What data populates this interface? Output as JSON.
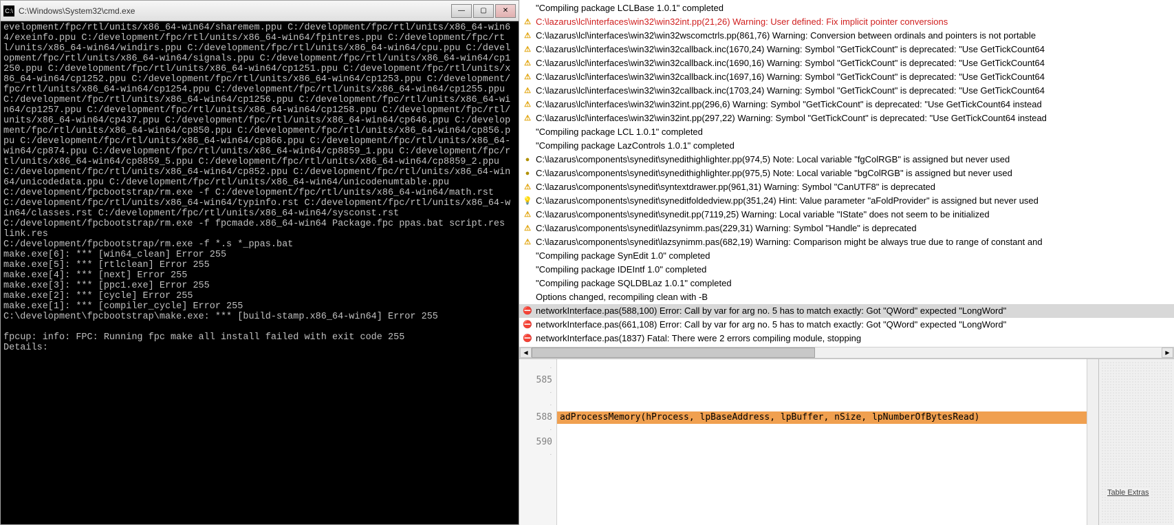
{
  "cmd": {
    "title": "C:\\Windows\\System32\\cmd.exe",
    "icon_text": "C:\\",
    "body": "evelopment/fpc/rtl/units/x86_64-win64/sharemem.ppu C:/development/fpc/rtl/units/x86_64-win64/exeinfo.ppu C:/development/fpc/rtl/units/x86_64-win64/fpintres.ppu C:/development/fpc/rtl/units/x86_64-win64/windirs.ppu C:/development/fpc/rtl/units/x86_64-win64/cpu.ppu C:/development/fpc/rtl/units/x86_64-win64/signals.ppu C:/development/fpc/rtl/units/x86_64-win64/cp1250.ppu C:/development/fpc/rtl/units/x86_64-win64/cp1251.ppu C:/development/fpc/rtl/units/x86_64-win64/cp1252.ppu C:/development/fpc/rtl/units/x86_64-win64/cp1253.ppu C:/development/fpc/rtl/units/x86_64-win64/cp1254.ppu C:/development/fpc/rtl/units/x86_64-win64/cp1255.ppu C:/development/fpc/rtl/units/x86_64-win64/cp1256.ppu C:/development/fpc/rtl/units/x86_64-win64/cp1257.ppu C:/development/fpc/rtl/units/x86_64-win64/cp1258.ppu C:/development/fpc/rtl/units/x86_64-win64/cp437.ppu C:/development/fpc/rtl/units/x86_64-win64/cp646.ppu C:/development/fpc/rtl/units/x86_64-win64/cp850.ppu C:/development/fpc/rtl/units/x86_64-win64/cp856.ppu C:/development/fpc/rtl/units/x86_64-win64/cp866.ppu C:/development/fpc/rtl/units/x86_64-win64/cp874.ppu C:/development/fpc/rtl/units/x86_64-win64/cp8859_1.ppu C:/development/fpc/rtl/units/x86_64-win64/cp8859_5.ppu C:/development/fpc/rtl/units/x86_64-win64/cp8859_2.ppu C:/development/fpc/rtl/units/x86_64-win64/cp852.ppu C:/development/fpc/rtl/units/x86_64-win64/unicodedata.ppu C:/development/fpc/rtl/units/x86_64-win64/unicodenumtable.ppu\nC:/development/fpcbootstrap/rm.exe -f C:/development/fpc/rtl/units/x86_64-win64/math.rst C:/development/fpc/rtl/units/x86_64-win64/typinfo.rst C:/development/fpc/rtl/units/x86_64-win64/classes.rst C:/development/fpc/rtl/units/x86_64-win64/sysconst.rst\nC:/development/fpcbootstrap/rm.exe -f fpcmade.x86_64-win64 Package.fpc ppas.bat script.res link.res\nC:/development/fpcbootstrap/rm.exe -f *.s *_ppas.bat\nmake.exe[6]: *** [win64_clean] Error 255\nmake.exe[5]: *** [rtlclean] Error 255\nmake.exe[4]: *** [next] Error 255\nmake.exe[3]: *** [ppc1.exe] Error 255\nmake.exe[2]: *** [cycle] Error 255\nmake.exe[1]: *** [compiler_cycle] Error 255\nC:\\development\\fpcbootstrap\\make.exe: *** [build-stamp.x86_64-win64] Error 255\n\nfpcup: info: FPC: Running fpc make all install failed with exit code 255\nDetails:"
  },
  "messages": [
    {
      "icon": "",
      "cls": "",
      "text": "\"Compiling package LCLBase 1.0.1\" completed"
    },
    {
      "icon": "⚠",
      "cls": "icon-warning",
      "text": "C:\\lazarus\\lcl\\interfaces\\win32\\win32int.pp(21,26) Warning: User defined: Fix implicit pointer conversions",
      "red": true
    },
    {
      "icon": "⚠",
      "cls": "icon-warning",
      "text": "C:\\lazarus\\lcl\\interfaces\\win32\\win32wscomctrls.pp(861,76) Warning: Conversion between ordinals and pointers is not portable"
    },
    {
      "icon": "⚠",
      "cls": "icon-warning",
      "text": "C:\\lazarus\\lcl\\interfaces\\win32\\win32callback.inc(1670,24) Warning: Symbol \"GetTickCount\" is deprecated: \"Use GetTickCount64"
    },
    {
      "icon": "⚠",
      "cls": "icon-warning",
      "text": "C:\\lazarus\\lcl\\interfaces\\win32\\win32callback.inc(1690,16) Warning: Symbol \"GetTickCount\" is deprecated: \"Use GetTickCount64"
    },
    {
      "icon": "⚠",
      "cls": "icon-warning",
      "text": "C:\\lazarus\\lcl\\interfaces\\win32\\win32callback.inc(1697,16) Warning: Symbol \"GetTickCount\" is deprecated: \"Use GetTickCount64"
    },
    {
      "icon": "⚠",
      "cls": "icon-warning",
      "text": "C:\\lazarus\\lcl\\interfaces\\win32\\win32callback.inc(1703,24) Warning: Symbol \"GetTickCount\" is deprecated: \"Use GetTickCount64"
    },
    {
      "icon": "⚠",
      "cls": "icon-warning",
      "text": "C:\\lazarus\\lcl\\interfaces\\win32\\win32int.pp(296,6) Warning: Symbol \"GetTickCount\" is deprecated: \"Use GetTickCount64 instead"
    },
    {
      "icon": "⚠",
      "cls": "icon-warning",
      "text": "C:\\lazarus\\lcl\\interfaces\\win32\\win32int.pp(297,22) Warning: Symbol \"GetTickCount\" is deprecated: \"Use GetTickCount64 instead"
    },
    {
      "icon": "",
      "cls": "",
      "text": "\"Compiling package LCL 1.0.1\" completed"
    },
    {
      "icon": "",
      "cls": "",
      "text": "\"Compiling package LazControls 1.0.1\" completed"
    },
    {
      "icon": "●",
      "cls": "icon-note",
      "text": "C:\\lazarus\\components\\synedit\\synedithighlighter.pp(974,5) Note: Local variable \"fgColRGB\" is assigned but never used"
    },
    {
      "icon": "●",
      "cls": "icon-note",
      "text": "C:\\lazarus\\components\\synedit\\synedithighlighter.pp(975,5) Note: Local variable \"bgColRGB\" is assigned but never used"
    },
    {
      "icon": "⚠",
      "cls": "icon-warning",
      "text": "C:\\lazarus\\components\\synedit\\syntextdrawer.pp(961,31) Warning: Symbol \"CanUTF8\" is deprecated"
    },
    {
      "icon": "💡",
      "cls": "icon-hint",
      "text": "C:\\lazarus\\components\\synedit\\syneditfoldedview.pp(351,24) Hint: Value parameter \"aFoldProvider\" is assigned but never used"
    },
    {
      "icon": "⚠",
      "cls": "icon-warning",
      "text": "C:\\lazarus\\components\\synedit\\synedit.pp(7119,25) Warning: Local variable \"IState\" does not seem to be initialized"
    },
    {
      "icon": "⚠",
      "cls": "icon-warning",
      "text": "C:\\lazarus\\components\\synedit\\lazsynimm.pas(229,31) Warning: Symbol \"Handle\" is deprecated"
    },
    {
      "icon": "⚠",
      "cls": "icon-warning",
      "text": "C:\\lazarus\\components\\synedit\\lazsynimm.pas(682,19) Warning: Comparison might be always true due to range of constant and"
    },
    {
      "icon": "",
      "cls": "",
      "text": "\"Compiling package SynEdit 1.0\" completed"
    },
    {
      "icon": "",
      "cls": "",
      "text": "\"Compiling package IDEIntf 1.0\" completed"
    },
    {
      "icon": "",
      "cls": "",
      "text": "\"Compiling package SQLDBLaz 1.0.1\" completed"
    },
    {
      "icon": "",
      "cls": "",
      "text": "Options changed, recompiling clean with -B"
    },
    {
      "icon": "⛔",
      "cls": "icon-error",
      "text": "networkInterface.pas(588,100) Error: Call by var for arg no. 5 has to match exactly: Got \"QWord\" expected \"LongWord\"",
      "sel": true
    },
    {
      "icon": "⛔",
      "cls": "icon-error",
      "text": "networkInterface.pas(661,108) Error: Call by var for arg no. 5 has to match exactly: Got \"QWord\" expected \"LongWord\""
    },
    {
      "icon": "⛔",
      "cls": "icon-fatal",
      "text": "networkInterface.pas(1837) Fatal: There were 2 errors compiling module, stopping"
    }
  ],
  "editor": {
    "gutter": [
      "·",
      "585",
      "·",
      "·",
      "588",
      "·",
      "590",
      "·"
    ],
    "lines": [
      "",
      "",
      "",
      "",
      "adProcessMemory(hProcess, lpBaseAddress, lpBuffer, nSize, lpNumberOfBytesRead)",
      "",
      "",
      ""
    ],
    "highlight_index": 4
  },
  "side_panel": {
    "label": "Table Extras"
  },
  "win_buttons": {
    "min": "—",
    "max": "▢",
    "close": "✕"
  }
}
